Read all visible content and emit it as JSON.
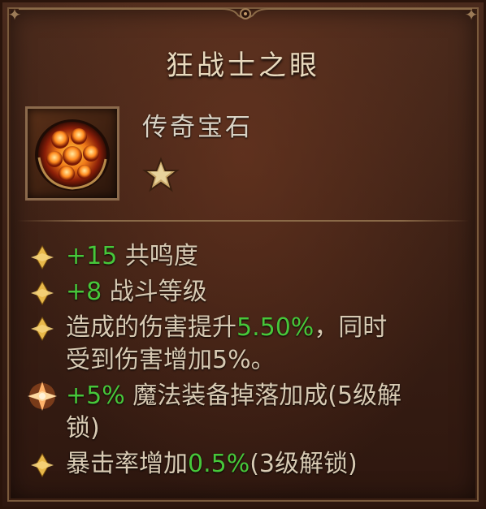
{
  "tooltip": {
    "title": "狂战士之眼",
    "item_type": "传奇宝石",
    "star_icon": "star-icon",
    "item_icon": "legendary-gem-icon",
    "stats": [
      {
        "value": "+15",
        "label": " 共鸣度"
      },
      {
        "value": "+8",
        "label": " 战斗等级"
      },
      {
        "prefix": "造成的伤害提升",
        "value": "5.50%",
        "suffix": "，同时"
      },
      {
        "text": "受到伤害增加5%。"
      },
      {
        "value": "+5%",
        "label": " 魔法装备掉落加成(5级解"
      },
      {
        "text": "锁)"
      },
      {
        "prefix": "暴击率增加",
        "value": "0.5%",
        "suffix": "(3级解锁)"
      }
    ]
  },
  "colors": {
    "highlight_green": "#47c73a",
    "title": "#e8d9bd",
    "text": "#d8cab3"
  }
}
